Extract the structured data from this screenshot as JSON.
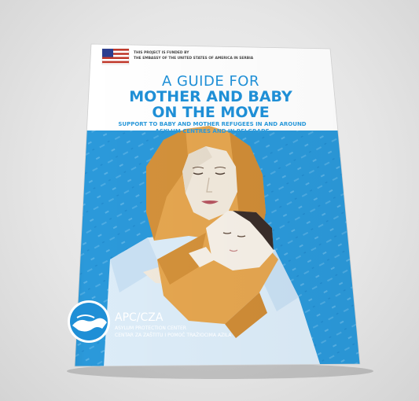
{
  "cover": {
    "funding_line1": "THIS PROJECT IS FUNDED BY",
    "funding_line2": "THE EMBASSY OF THE UNITED STATES OF AMERICA IN SERBIA",
    "title_line1": "A GUIDE FOR",
    "title_line2": "MOTHER AND BABY",
    "title_line3": "ON THE MOVE",
    "subtitle_line1": "SUPPORT TO BABY AND MOTHER REFUGEES IN AND AROUND",
    "subtitle_line2": "ASYLUM CENTRES AND IN BELGRADE",
    "org_name": "APC/CZA",
    "org_line1": "ASYLUM PROTECTION CENTER",
    "org_line2": "CENTAR ZA ZAŠTITU I POMOĆ TRAŽIOCIMA AZILA"
  },
  "colors": {
    "brand_blue": "#1f8fd6",
    "cover_blue": "#2b99da",
    "headscarf": "#e5a650",
    "skin": "#f1e9dc",
    "white": "#ffffff"
  }
}
